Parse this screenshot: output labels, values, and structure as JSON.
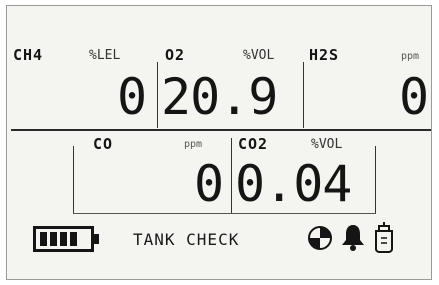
{
  "display": {
    "row1": [
      {
        "gas": "CH4",
        "unit": "%LEL",
        "value": "0"
      },
      {
        "gas": "O2",
        "unit": "%VOL",
        "value": "20.9"
      },
      {
        "gas": "H2S",
        "unit": "ppm",
        "value": "0"
      }
    ],
    "row2": [
      {
        "gas": "CO",
        "unit": "ppm",
        "value": "0"
      },
      {
        "gas": "CO2",
        "unit": "%VOL",
        "value": "0.04"
      }
    ]
  },
  "status": {
    "mode_text": "TANK CHECK"
  },
  "icons": {
    "battery": "battery-icon",
    "calibration": "calibration-icon",
    "alarm": "bell-icon",
    "pump": "pump-icon"
  },
  "colors": {
    "lcd_background": "#f4f4f0",
    "lcd_foreground": "#151515"
  }
}
